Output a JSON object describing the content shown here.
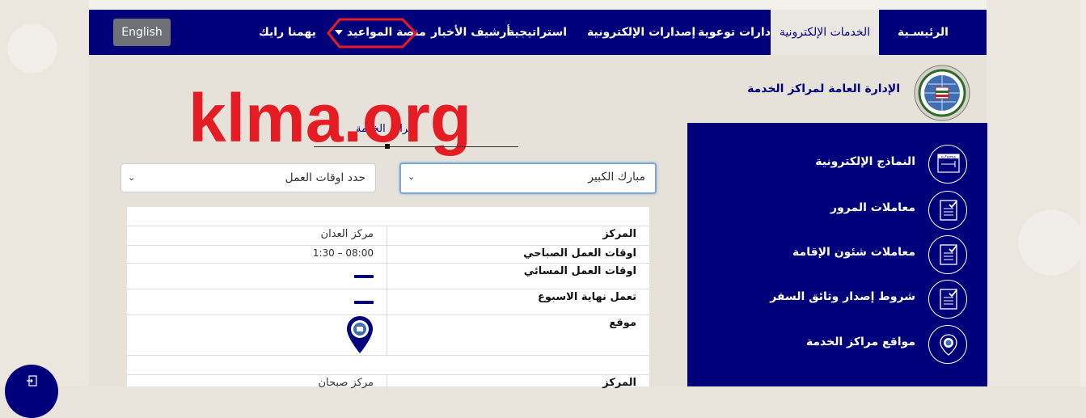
{
  "nav": {
    "items": [
      "الرئيسـية",
      "الخدمات الإلكترونية",
      "إدارات توعوية",
      "إصدارات الإلكترونية",
      "استراتيجية",
      "أرشيف الأخبار",
      "منصة المواعيد",
      "يهمنا رايك"
    ],
    "language_button": "English",
    "active_index": 1
  },
  "header": {
    "department_name": "الإدارة العامة لمراكز الخدمة",
    "watermark": "klma.org",
    "breadcrumb": "مراكز الخدمة"
  },
  "filters": {
    "governorate_selected": "مبارك الكبير",
    "hours_selected": "حدد اوقات العمل"
  },
  "centers": [
    {
      "center_label": "المركز",
      "center_value": "مركز العدان",
      "morning_label": "اوقات العمل الصباحي",
      "morning_value": "08:00 – 1:30",
      "evening_label": "اوقات العمل المسائي",
      "weekend_label": "تعمل نهاية الاسبوع",
      "location_label": "موقع"
    },
    {
      "center_label": "المركز",
      "center_value": "مركز صبحان"
    }
  ],
  "sidebar": {
    "items": [
      {
        "label": "النماذج الإلكترونية",
        "icon": "e-forms-icon",
        "icon_text": "e-Forms"
      },
      {
        "label": "معاملات المرور",
        "icon": "document-check-icon"
      },
      {
        "label": "معاملات شئون الإقامة",
        "icon": "document-check-icon"
      },
      {
        "label": "شروط إصدار وثائق السفر",
        "icon": "document-check-icon"
      },
      {
        "label": "مواقع مراكز الخدمة",
        "icon": "location-pin-icon"
      }
    ]
  },
  "colors": {
    "navy": "#00007a",
    "highlight": "#e61c24",
    "background": "#e6e2da"
  }
}
